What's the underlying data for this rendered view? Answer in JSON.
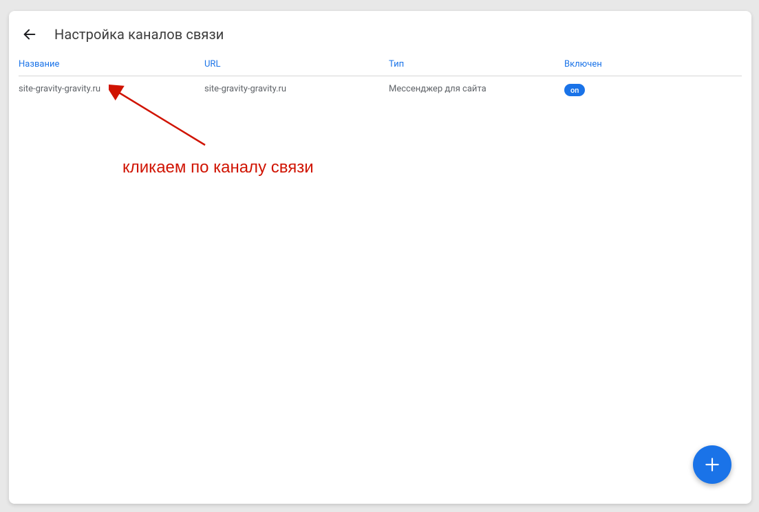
{
  "header": {
    "title": "Настройка каналов связи"
  },
  "table": {
    "headers": {
      "name": "Название",
      "url": "URL",
      "type": "Тип",
      "enabled": "Включен"
    },
    "rows": [
      {
        "name": "site-gravity-gravity.ru",
        "url": "site-gravity-gravity.ru",
        "type": "Мессенджер для сайта",
        "enabled_label": "on"
      }
    ]
  },
  "annotation": {
    "text": "кликаем по каналу связи"
  }
}
